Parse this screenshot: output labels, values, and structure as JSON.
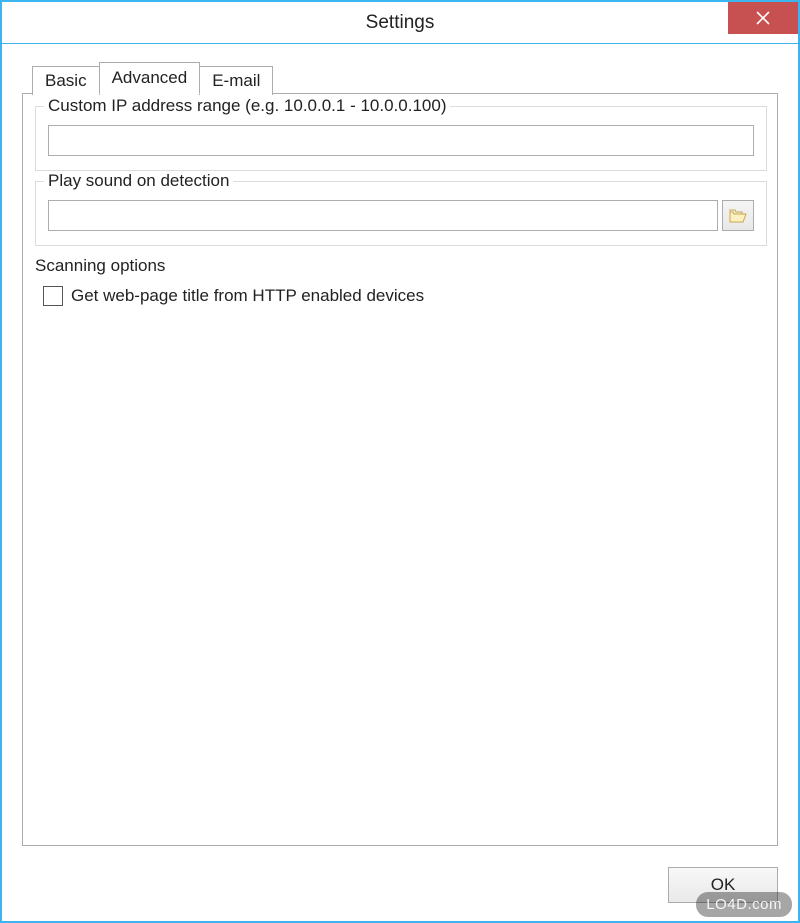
{
  "window": {
    "title": "Settings"
  },
  "tabs": {
    "basic": "Basic",
    "advanced": "Advanced",
    "email": "E-mail",
    "active": "advanced"
  },
  "groups": {
    "ip_range": {
      "title": "Custom IP address range (e.g. 10.0.0.1 - 10.0.0.100)",
      "value": ""
    },
    "sound": {
      "title": "Play sound on detection",
      "value": ""
    },
    "scanning": {
      "title": "Scanning options",
      "checkbox_label": "Get web-page title from HTTP enabled devices",
      "checkbox_checked": false
    }
  },
  "buttons": {
    "ok": "OK"
  },
  "watermark": "LO4D.com"
}
